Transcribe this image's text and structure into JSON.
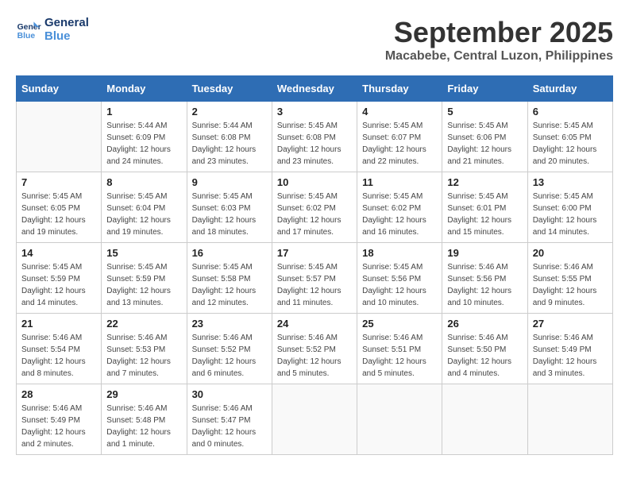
{
  "header": {
    "logo_line1": "General",
    "logo_line2": "Blue",
    "month_year": "September 2025",
    "location": "Macabebe, Central Luzon, Philippines"
  },
  "weekdays": [
    "Sunday",
    "Monday",
    "Tuesday",
    "Wednesday",
    "Thursday",
    "Friday",
    "Saturday"
  ],
  "weeks": [
    [
      {
        "day": "",
        "sunrise": "",
        "sunset": "",
        "daylight": ""
      },
      {
        "day": "1",
        "sunrise": "Sunrise: 5:44 AM",
        "sunset": "Sunset: 6:09 PM",
        "daylight": "Daylight: 12 hours and 24 minutes."
      },
      {
        "day": "2",
        "sunrise": "Sunrise: 5:44 AM",
        "sunset": "Sunset: 6:08 PM",
        "daylight": "Daylight: 12 hours and 23 minutes."
      },
      {
        "day": "3",
        "sunrise": "Sunrise: 5:45 AM",
        "sunset": "Sunset: 6:08 PM",
        "daylight": "Daylight: 12 hours and 23 minutes."
      },
      {
        "day": "4",
        "sunrise": "Sunrise: 5:45 AM",
        "sunset": "Sunset: 6:07 PM",
        "daylight": "Daylight: 12 hours and 22 minutes."
      },
      {
        "day": "5",
        "sunrise": "Sunrise: 5:45 AM",
        "sunset": "Sunset: 6:06 PM",
        "daylight": "Daylight: 12 hours and 21 minutes."
      },
      {
        "day": "6",
        "sunrise": "Sunrise: 5:45 AM",
        "sunset": "Sunset: 6:05 PM",
        "daylight": "Daylight: 12 hours and 20 minutes."
      }
    ],
    [
      {
        "day": "7",
        "sunrise": "Sunrise: 5:45 AM",
        "sunset": "Sunset: 6:05 PM",
        "daylight": "Daylight: 12 hours and 19 minutes."
      },
      {
        "day": "8",
        "sunrise": "Sunrise: 5:45 AM",
        "sunset": "Sunset: 6:04 PM",
        "daylight": "Daylight: 12 hours and 19 minutes."
      },
      {
        "day": "9",
        "sunrise": "Sunrise: 5:45 AM",
        "sunset": "Sunset: 6:03 PM",
        "daylight": "Daylight: 12 hours and 18 minutes."
      },
      {
        "day": "10",
        "sunrise": "Sunrise: 5:45 AM",
        "sunset": "Sunset: 6:02 PM",
        "daylight": "Daylight: 12 hours and 17 minutes."
      },
      {
        "day": "11",
        "sunrise": "Sunrise: 5:45 AM",
        "sunset": "Sunset: 6:02 PM",
        "daylight": "Daylight: 12 hours and 16 minutes."
      },
      {
        "day": "12",
        "sunrise": "Sunrise: 5:45 AM",
        "sunset": "Sunset: 6:01 PM",
        "daylight": "Daylight: 12 hours and 15 minutes."
      },
      {
        "day": "13",
        "sunrise": "Sunrise: 5:45 AM",
        "sunset": "Sunset: 6:00 PM",
        "daylight": "Daylight: 12 hours and 14 minutes."
      }
    ],
    [
      {
        "day": "14",
        "sunrise": "Sunrise: 5:45 AM",
        "sunset": "Sunset: 5:59 PM",
        "daylight": "Daylight: 12 hours and 14 minutes."
      },
      {
        "day": "15",
        "sunrise": "Sunrise: 5:45 AM",
        "sunset": "Sunset: 5:59 PM",
        "daylight": "Daylight: 12 hours and 13 minutes."
      },
      {
        "day": "16",
        "sunrise": "Sunrise: 5:45 AM",
        "sunset": "Sunset: 5:58 PM",
        "daylight": "Daylight: 12 hours and 12 minutes."
      },
      {
        "day": "17",
        "sunrise": "Sunrise: 5:45 AM",
        "sunset": "Sunset: 5:57 PM",
        "daylight": "Daylight: 12 hours and 11 minutes."
      },
      {
        "day": "18",
        "sunrise": "Sunrise: 5:45 AM",
        "sunset": "Sunset: 5:56 PM",
        "daylight": "Daylight: 12 hours and 10 minutes."
      },
      {
        "day": "19",
        "sunrise": "Sunrise: 5:46 AM",
        "sunset": "Sunset: 5:56 PM",
        "daylight": "Daylight: 12 hours and 10 minutes."
      },
      {
        "day": "20",
        "sunrise": "Sunrise: 5:46 AM",
        "sunset": "Sunset: 5:55 PM",
        "daylight": "Daylight: 12 hours and 9 minutes."
      }
    ],
    [
      {
        "day": "21",
        "sunrise": "Sunrise: 5:46 AM",
        "sunset": "Sunset: 5:54 PM",
        "daylight": "Daylight: 12 hours and 8 minutes."
      },
      {
        "day": "22",
        "sunrise": "Sunrise: 5:46 AM",
        "sunset": "Sunset: 5:53 PM",
        "daylight": "Daylight: 12 hours and 7 minutes."
      },
      {
        "day": "23",
        "sunrise": "Sunrise: 5:46 AM",
        "sunset": "Sunset: 5:52 PM",
        "daylight": "Daylight: 12 hours and 6 minutes."
      },
      {
        "day": "24",
        "sunrise": "Sunrise: 5:46 AM",
        "sunset": "Sunset: 5:52 PM",
        "daylight": "Daylight: 12 hours and 5 minutes."
      },
      {
        "day": "25",
        "sunrise": "Sunrise: 5:46 AM",
        "sunset": "Sunset: 5:51 PM",
        "daylight": "Daylight: 12 hours and 5 minutes."
      },
      {
        "day": "26",
        "sunrise": "Sunrise: 5:46 AM",
        "sunset": "Sunset: 5:50 PM",
        "daylight": "Daylight: 12 hours and 4 minutes."
      },
      {
        "day": "27",
        "sunrise": "Sunrise: 5:46 AM",
        "sunset": "Sunset: 5:49 PM",
        "daylight": "Daylight: 12 hours and 3 minutes."
      }
    ],
    [
      {
        "day": "28",
        "sunrise": "Sunrise: 5:46 AM",
        "sunset": "Sunset: 5:49 PM",
        "daylight": "Daylight: 12 hours and 2 minutes."
      },
      {
        "day": "29",
        "sunrise": "Sunrise: 5:46 AM",
        "sunset": "Sunset: 5:48 PM",
        "daylight": "Daylight: 12 hours and 1 minute."
      },
      {
        "day": "30",
        "sunrise": "Sunrise: 5:46 AM",
        "sunset": "Sunset: 5:47 PM",
        "daylight": "Daylight: 12 hours and 0 minutes."
      },
      {
        "day": "",
        "sunrise": "",
        "sunset": "",
        "daylight": ""
      },
      {
        "day": "",
        "sunrise": "",
        "sunset": "",
        "daylight": ""
      },
      {
        "day": "",
        "sunrise": "",
        "sunset": "",
        "daylight": ""
      },
      {
        "day": "",
        "sunrise": "",
        "sunset": "",
        "daylight": ""
      }
    ]
  ]
}
